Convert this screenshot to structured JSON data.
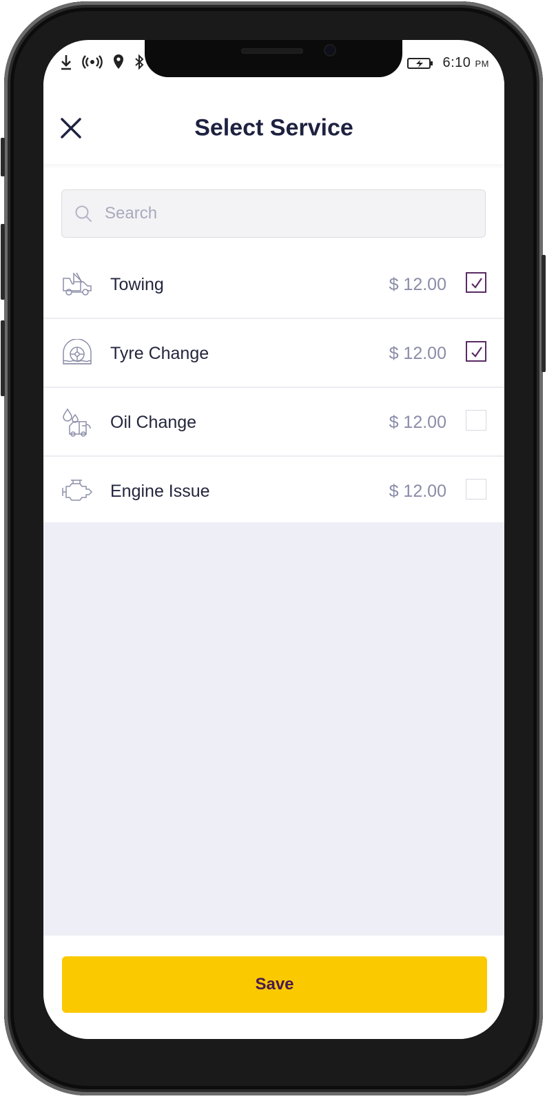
{
  "status_bar": {
    "time": "6:10",
    "ampm": "PM"
  },
  "header": {
    "title": "Select Service"
  },
  "search": {
    "placeholder": "Search"
  },
  "services": [
    {
      "label": "Towing",
      "price": "$ 12.00",
      "checked": true,
      "icon": "tow-truck-icon"
    },
    {
      "label": "Tyre Change",
      "price": "$ 12.00",
      "checked": true,
      "icon": "tyre-icon"
    },
    {
      "label": "Oil Change",
      "price": "$ 12.00",
      "checked": false,
      "icon": "oil-change-icon"
    },
    {
      "label": "Engine Issue",
      "price": "$ 12.00",
      "checked": false,
      "icon": "engine-icon"
    }
  ],
  "footer": {
    "save_label": "Save"
  },
  "colors": {
    "accent": "#fbc900",
    "check": "#5a2a63",
    "title": "#1e2240",
    "price": "#8a8ca8",
    "empty_bg": "#eeeff6"
  }
}
